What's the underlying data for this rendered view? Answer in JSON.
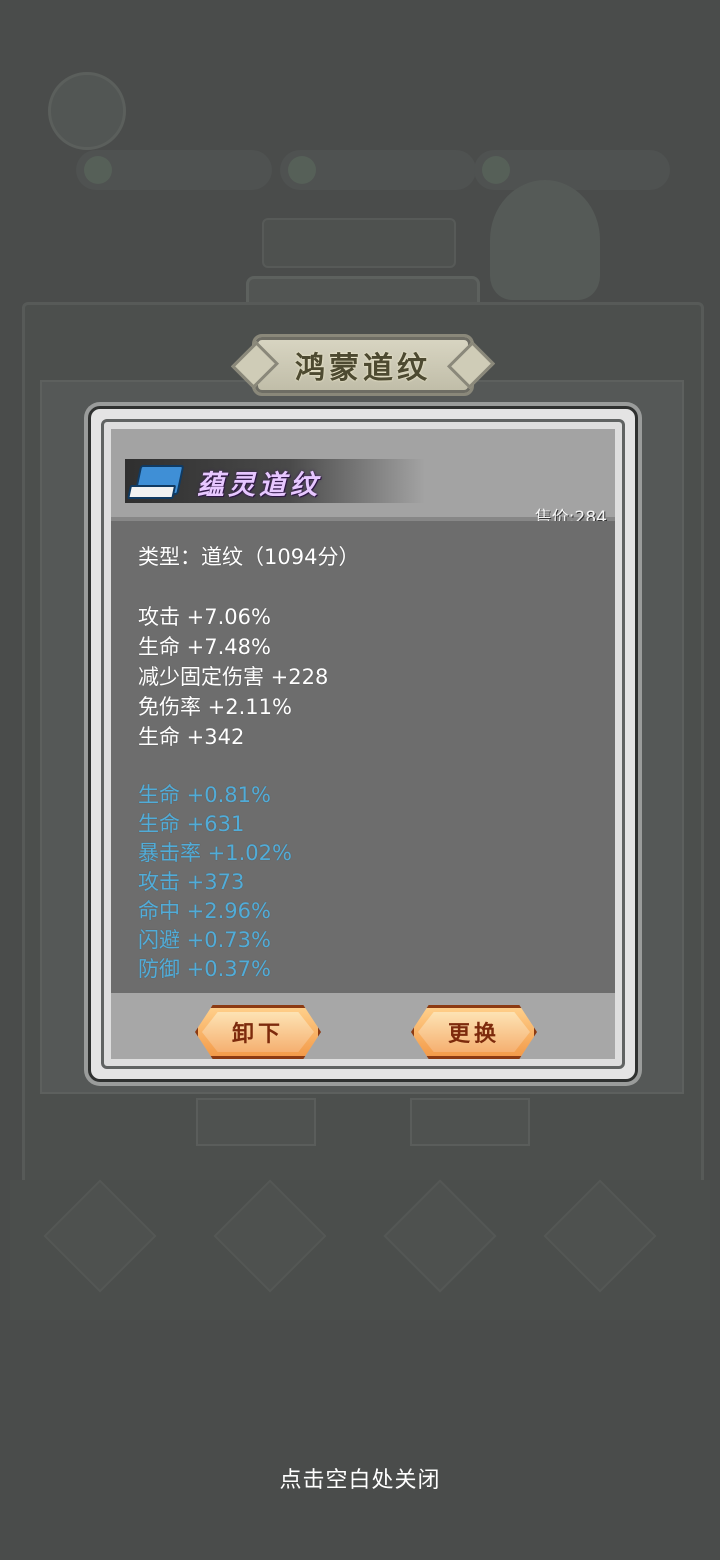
{
  "header": {
    "title": "鸿蒙道纹"
  },
  "item": {
    "name": "蕴灵道纹",
    "price": "售价:284",
    "type_line": "类型：道纹（1094分）"
  },
  "main_stats": [
    "攻击 +7.06%",
    "生命 +7.48%",
    "减少固定伤害 +228",
    "免伤率 +2.11%",
    "生命 +342"
  ],
  "extra_stats": [
    "生命 +0.81%",
    "生命 +631",
    "暴击率 +1.02%",
    "攻击 +373",
    "命中 +2.96%",
    "闪避 +0.73%",
    "防御 +0.37%"
  ],
  "buttons": {
    "unequip": "卸下",
    "replace": "更换"
  },
  "close_hint": "点击空白处关闭",
  "colors": {
    "extra_stat": "#51acd8",
    "item_name": "#e7c7ff",
    "button": "#f39b4a"
  },
  "icons": {
    "item": "book-icon"
  }
}
